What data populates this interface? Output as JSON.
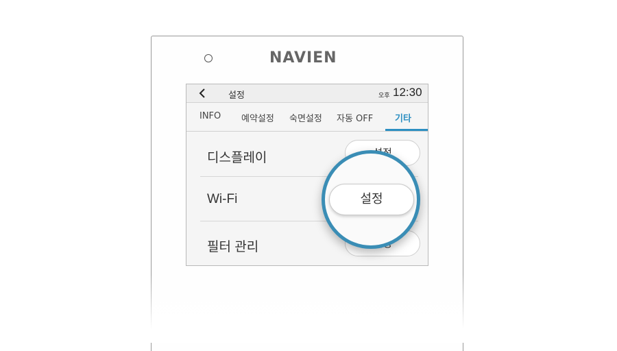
{
  "device": {
    "brand": "NAVIEN"
  },
  "status_bar": {
    "back_icon": "chevron-left-icon",
    "title": "설정",
    "ampm": "오후",
    "time": "12:30"
  },
  "tabs": [
    {
      "label": "INFO",
      "active": false
    },
    {
      "label": "예약설정",
      "active": false
    },
    {
      "label": "숙면설정",
      "active": false
    },
    {
      "label": "자동 OFF",
      "active": false
    },
    {
      "label": "기타",
      "active": true
    }
  ],
  "rows": [
    {
      "label": "디스플레이",
      "button": "설정"
    },
    {
      "label": "Wi-Fi",
      "button": "설정"
    },
    {
      "label": "필터 관리",
      "button": "설정"
    }
  ],
  "magnifier": {
    "button": "설정"
  },
  "colors": {
    "accent": "#2c8fc2",
    "magnifier_ring": "#3a8db5"
  }
}
